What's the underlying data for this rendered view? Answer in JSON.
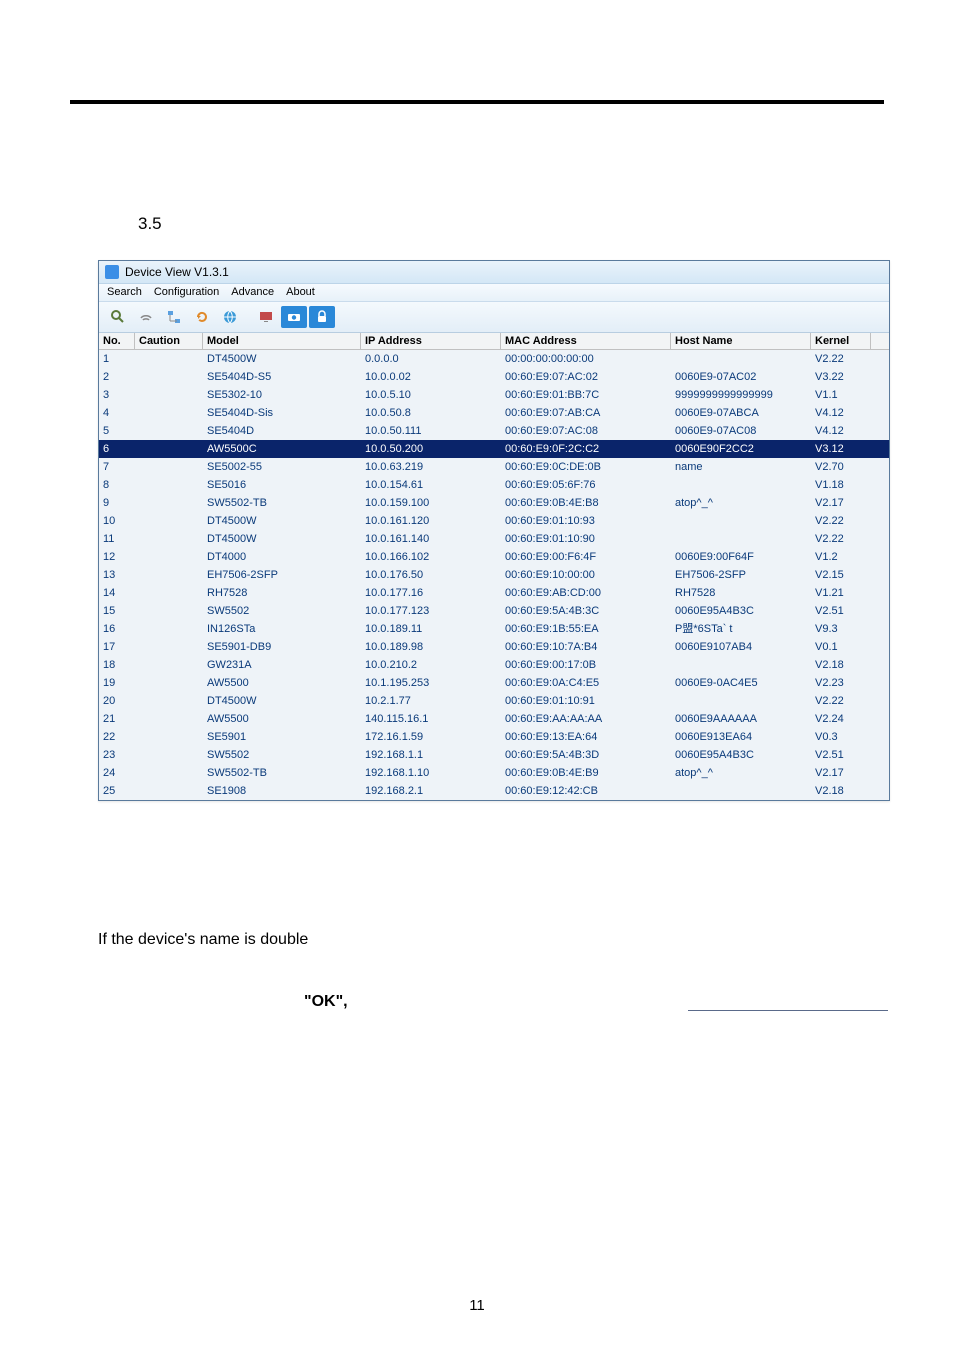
{
  "section_number": "3.5",
  "window": {
    "title": "Device View V1.3.1",
    "menu": [
      "Search",
      "Configuration",
      "Advance",
      "About"
    ],
    "headers": {
      "no": "No.",
      "caution": "Caution",
      "model": "Model",
      "ip": "IP Address",
      "mac": "MAC Address",
      "host": "Host Name",
      "kernel": "Kernel"
    },
    "rows": [
      {
        "no": "1",
        "cau": "",
        "mod": "DT4500W",
        "ip": "0.0.0.0",
        "mac": "00:00:00:00:00:00",
        "host": "",
        "ker": "V2.22"
      },
      {
        "no": "2",
        "cau": "",
        "mod": "SE5404D-S5",
        "ip": "10.0.0.02",
        "mac": "00:60:E9:07:AC:02",
        "host": "0060E9-07AC02",
        "ker": "V3.22"
      },
      {
        "no": "3",
        "cau": "",
        "mod": "SE5302-10",
        "ip": "10.0.5.10",
        "mac": "00:60:E9:01:BB:7C",
        "host": "9999999999999999",
        "ker": "V1.1"
      },
      {
        "no": "4",
        "cau": "",
        "mod": "SE5404D-Sis",
        "ip": "10.0.50.8",
        "mac": "00:60:E9:07:AB:CA",
        "host": "0060E9-07ABCA",
        "ker": "V4.12"
      },
      {
        "no": "5",
        "cau": "",
        "mod": "SE5404D",
        "ip": "10.0.50.111",
        "mac": "00:60:E9:07:AC:08",
        "host": "0060E9-07AC08",
        "ker": "V4.12"
      },
      {
        "no": "6",
        "cau": "",
        "mod": "AW5500C",
        "ip": "10.0.50.200",
        "mac": "00:60:E9:0F:2C:C2",
        "host": "0060E90F2CC2",
        "ker": "V3.12",
        "sel": true
      },
      {
        "no": "7",
        "cau": "",
        "mod": "SE5002-55",
        "ip": "10.0.63.219",
        "mac": "00:60:E9:0C:DE:0B",
        "host": "name",
        "ker": "V2.70"
      },
      {
        "no": "8",
        "cau": "",
        "mod": "SE5016",
        "ip": "10.0.154.61",
        "mac": "00:60:E9:05:6F:76",
        "host": "",
        "ker": "V1.18"
      },
      {
        "no": "9",
        "cau": "",
        "mod": "SW5502-TB",
        "ip": "10.0.159.100",
        "mac": "00:60:E9:0B:4E:B8",
        "host": "atop^_^",
        "ker": "V2.17"
      },
      {
        "no": "10",
        "cau": "",
        "mod": "DT4500W",
        "ip": "10.0.161.120",
        "mac": "00:60:E9:01:10:93",
        "host": "",
        "ker": "V2.22"
      },
      {
        "no": "11",
        "cau": "",
        "mod": "DT4500W",
        "ip": "10.0.161.140",
        "mac": "00:60:E9:01:10:90",
        "host": "",
        "ker": "V2.22"
      },
      {
        "no": "12",
        "cau": "",
        "mod": "DT4000",
        "ip": "10.0.166.102",
        "mac": "00:60:E9:00:F6:4F",
        "host": "0060E9:00F64F",
        "ker": "V1.2"
      },
      {
        "no": "13",
        "cau": "",
        "mod": "EH7506-2SFP",
        "ip": "10.0.176.50",
        "mac": "00:60:E9:10:00:00",
        "host": "EH7506-2SFP",
        "ker": "V2.15"
      },
      {
        "no": "14",
        "cau": "",
        "mod": "RH7528",
        "ip": "10.0.177.16",
        "mac": "00:60:E9:AB:CD:00",
        "host": "RH7528",
        "ker": "V1.21"
      },
      {
        "no": "15",
        "cau": "",
        "mod": "SW5502",
        "ip": "10.0.177.123",
        "mac": "00:60:E9:5A:4B:3C",
        "host": "0060E95A4B3C",
        "ker": "V2.51"
      },
      {
        "no": "16",
        "cau": "",
        "mod": "IN126STa",
        "ip": "10.0.189.11",
        "mac": "00:60:E9:1B:55:EA",
        "host": "P盟*6STa`  t",
        "ker": "V9.3"
      },
      {
        "no": "17",
        "cau": "",
        "mod": "SE5901-DB9",
        "ip": "10.0.189.98",
        "mac": "00:60:E9:10:7A:B4",
        "host": "0060E9107AB4",
        "ker": "V0.1"
      },
      {
        "no": "18",
        "cau": "",
        "mod": "GW231A",
        "ip": "10.0.210.2",
        "mac": "00:60:E9:00:17:0B",
        "host": "",
        "ker": "V2.18"
      },
      {
        "no": "19",
        "cau": "",
        "mod": "AW5500",
        "ip": "10.1.195.253",
        "mac": "00:60:E9:0A:C4:E5",
        "host": "0060E9-0AC4E5",
        "ker": "V2.23"
      },
      {
        "no": "20",
        "cau": "",
        "mod": "DT4500W",
        "ip": "10.2.1.77",
        "mac": "00:60:E9:01:10:91",
        "host": "",
        "ker": "V2.22"
      },
      {
        "no": "21",
        "cau": "",
        "mod": "AW5500",
        "ip": "140.115.16.1",
        "mac": "00:60:E9:AA:AA:AA",
        "host": "0060E9AAAAAA",
        "ker": "V2.24"
      },
      {
        "no": "22",
        "cau": "",
        "mod": "SE5901",
        "ip": "172.16.1.59",
        "mac": "00:60:E9:13:EA:64",
        "host": "0060E913EA64",
        "ker": "V0.3"
      },
      {
        "no": "23",
        "cau": "",
        "mod": "SW5502",
        "ip": "192.168.1.1",
        "mac": "00:60:E9:5A:4B:3D",
        "host": "0060E95A4B3C",
        "ker": "V2.51"
      },
      {
        "no": "24",
        "cau": "",
        "mod": "SW5502-TB",
        "ip": "192.168.1.10",
        "mac": "00:60:E9:0B:4E:B9",
        "host": "atop^_^",
        "ker": "V2.17"
      },
      {
        "no": "25",
        "cau": "",
        "mod": "SE1908",
        "ip": "192.168.2.1",
        "mac": "00:60:E9:12:42:CB",
        "host": "",
        "ker": "V2.18"
      }
    ]
  },
  "paragraph1": "If the device's name is double",
  "ok_text": "\"OK\",",
  "page_number": "11"
}
